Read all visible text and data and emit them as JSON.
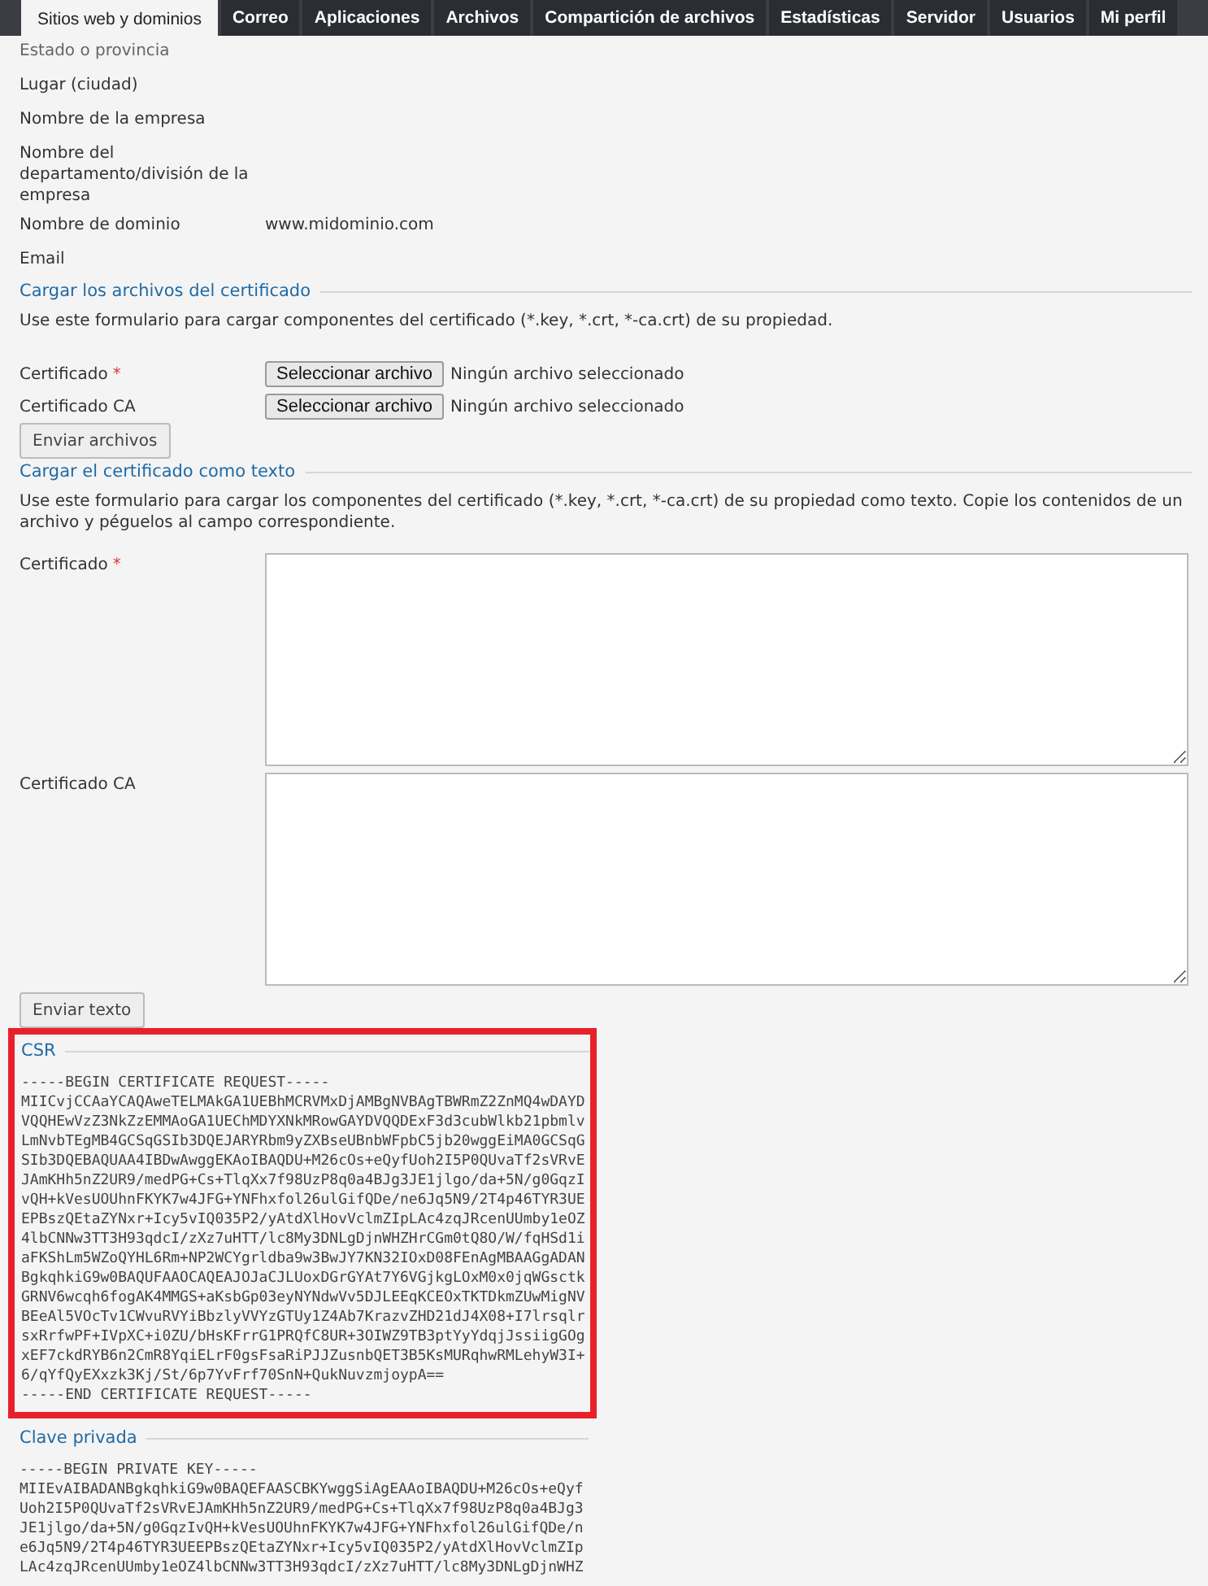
{
  "tabs": [
    {
      "label": "Sitios web y dominios",
      "selected": true
    },
    {
      "label": "Correo",
      "selected": false
    },
    {
      "label": "Aplicaciones",
      "selected": false
    },
    {
      "label": "Archivos",
      "selected": false
    },
    {
      "label": "Compartición de archivos",
      "selected": false
    },
    {
      "label": "Estadísticas",
      "selected": false
    },
    {
      "label": "Servidor",
      "selected": false
    },
    {
      "label": "Usuarios",
      "selected": false
    },
    {
      "label": "Mi perfil",
      "selected": false
    }
  ],
  "fields": [
    {
      "label": "Estado o provincia"
    },
    {
      "label": "Lugar (ciudad)"
    },
    {
      "label": "Nombre de la empresa"
    },
    {
      "label": "Nombre del departamento/división de la empresa"
    },
    {
      "label": "Nombre de dominio",
      "value": "www.midominio.com"
    },
    {
      "label": "Email"
    }
  ],
  "upload_files": {
    "title": "Cargar los archivos del certificado",
    "description": "Use este formulario para cargar componentes del certificado (*.key, *.crt, *-ca.crt) de su propiedad.",
    "inputs": [
      {
        "label": "Certificado",
        "required_mark": "*",
        "button": "Seleccionar archivo",
        "status": "Ningún archivo seleccionado"
      },
      {
        "label": "Certificado CA",
        "button": "Seleccionar archivo",
        "status": "Ningún archivo seleccionado"
      }
    ],
    "submit": "Enviar archivos"
  },
  "upload_text": {
    "title": "Cargar el certificado como texto",
    "description": "Use este formulario para cargar los componentes del certificado (*.key, *.crt, *-ca.crt) de su propiedad como texto. Copie los contenidos de un archivo y péguelos al campo correspondiente.",
    "textareas": [
      {
        "label": "Certificado",
        "required_mark": "*"
      },
      {
        "label": "Certificado CA"
      }
    ],
    "submit": "Enviar texto"
  },
  "csr": {
    "title": "CSR",
    "highlighted": true,
    "lines": [
      "-----BEGIN CERTIFICATE REQUEST-----",
      "MIICvjCCAaYCAQAweTELMAkGA1UEBhMCRVMxDjAMBgNVBAgTBWRmZ2ZnMQ4wDAYD",
      "VQQHEwVzZ3NkZzEMMAoGA1UEChMDYXNkMRowGAYDVQQDExF3d3cubWlkb21pbmlv",
      "LmNvbTEgMB4GCSqGSIb3DQEJARYRbm9yZXBseUBnbWFpbC5jb20wggEiMA0GCSqG",
      "SIb3DQEBAQUAA4IBDwAwggEKAoIBAQDU+M26cOs+eQyfUoh2I5P0QUvaTf2sVRvE",
      "JAmKHh5nZ2UR9/medPG+Cs+TlqXx7f98UzP8q0a4BJg3JE1jlgo/da+5N/g0GqzI",
      "vQH+kVesUOUhnFKYK7w4JFG+YNFhxfol26ulGifQDe/ne6Jq5N9/2T4p46TYR3UE",
      "EPBszQEtaZYNxr+Icy5vIQ035P2/yAtdXlHovVclmZIpLAc4zqJRcenUUmby1eOZ",
      "4lbCNNw3TT3H93qdcI/zXz7uHTT/lc8My3DNLgDjnWHZHrCGm0tQ8O/W/fqHSd1i",
      "aFKShLm5WZoQYHL6Rm+NP2WCYgrldba9w3BwJY7KN32IOxD08FEnAgMBAAGgADAN",
      "BgkqhkiG9w0BAQUFAAOCAQEAJOJaCJLUoxDGrGYAt7Y6VGjkgLOxM0x0jqWGsctk",
      "GRNV6wcqh6fogAK4MMGS+aKsbGp03eyNYNdwVv5DJLEEqKCEOxTKTDkmZUwMigNV",
      "BEeAl5VOcTv1CWvuRVYiBbzlyVVYzGTUy1Z4Ab7KrazvZHD21dJ4X08+I7lrsqlr",
      "sxRrfwPF+IVpXC+i0ZU/bHsKFrrG1PRQfC8UR+3OIWZ9TB3ptYyYdqjJssiigGOg",
      "xEF7ckdRYB6n2CmR8YqiELrF0gsFsaRiPJJZusnbQET3B5KsMURqhwRMLehyW3I+",
      "6/qYfQyEXxzk3Kj/St/6p7YvFrf70SnN+QukNuvzmjoypA==",
      "-----END CERTIFICATE REQUEST-----"
    ]
  },
  "private_key": {
    "title": "Clave privada",
    "highlighted": false,
    "lines": [
      "-----BEGIN PRIVATE KEY-----",
      "MIIEvAIBADANBgkqhkiG9w0BAQEFAASCBKYwggSiAgEAAoIBAQDU+M26cOs+eQyf",
      "Uoh2I5P0QUvaTf2sVRvEJAmKHh5nZ2UR9/medPG+Cs+TlqXx7f98UzP8q0a4BJg3",
      "JE1jlgo/da+5N/g0GqzIvQH+kVesUOUhnFKYK7w4JFG+YNFhxfol26ulGifQDe/n",
      "e6Jq5N9/2T4p46TYR3UEEPBszQEtaZYNxr+Icy5vIQ035P2/yAtdXlHovVclmZIp",
      "LAc4zqJRcenUUmby1eOZ4lbCNNw3TT3H93qdcI/zXz7uHTT/lc8My3DNLgDjnWHZ"
    ]
  }
}
